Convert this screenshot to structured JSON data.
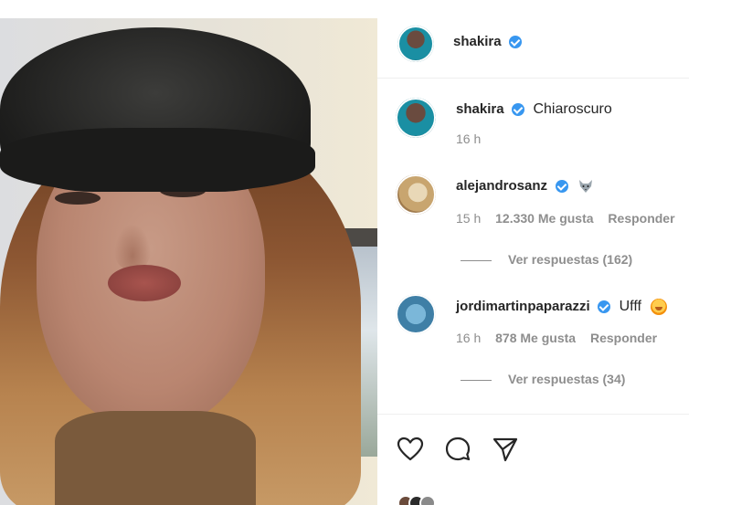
{
  "post": {
    "author": "shakira",
    "caption_author": "shakira",
    "caption": "Chiaroscuro",
    "caption_time": "16 h"
  },
  "comments": [
    {
      "user": "alejandrosanz",
      "text": "",
      "emoji": "wolf-emoji",
      "time": "15 h",
      "likes": "12.330 Me gusta",
      "reply": "Responder",
      "replies_label": "Ver respuestas (162)"
    },
    {
      "user": "jordimartinpaparazzi",
      "text": "Ufff",
      "emoji": "blushing-face-emoji",
      "time": "16 h",
      "likes": "878 Me gusta",
      "reply": "Responder",
      "replies_label": "Ver respuestas (34)"
    }
  ],
  "actions": {
    "icons": [
      "heart-icon",
      "comment-icon",
      "share-icon"
    ]
  },
  "colors": {
    "verified": "#3897f0",
    "text": "#262626",
    "muted": "#8e8e8e",
    "divider": "#efefef"
  }
}
